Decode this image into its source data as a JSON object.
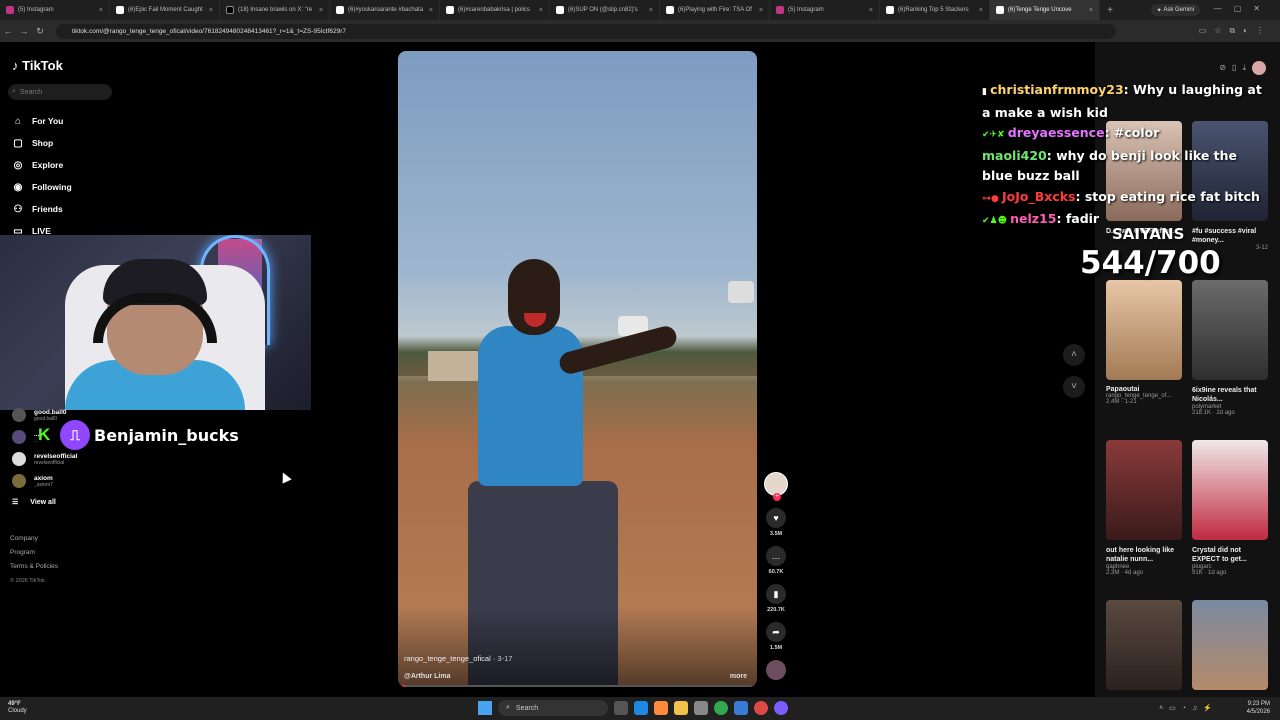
{
  "browser": {
    "tabs": [
      {
        "title": "(5) Instagram"
      },
      {
        "title": "(6)Epic Fail Moment Caught"
      },
      {
        "title": "(18) Insane brawls on X: \"re"
      },
      {
        "title": "(6)#yoskaroarante #bachata"
      },
      {
        "title": "(6)#carenbabakrisa | polics"
      },
      {
        "title": "(6)SUP ON (@slip.cn82)'s"
      },
      {
        "title": "(6)Playing with Fire: TSA Of"
      },
      {
        "title": "(5) Instagram"
      },
      {
        "title": "(6)Ranking Top 5 Stackers"
      },
      {
        "title": "(6)Tenge Tenge Uncove"
      }
    ],
    "new_tab": "+",
    "ask_gemini": "Ask Gemini",
    "url": "tiktok.com/@rango_tenge_tenge_ofical/video/7618249480248413461?_r=1&_t=ZS-95Ictf629r7"
  },
  "sidebar": {
    "logo": "TikTok",
    "search_placeholder": "Search",
    "nav": [
      {
        "label": "For You",
        "icon": "home-icon"
      },
      {
        "label": "Shop",
        "icon": "bag-icon"
      },
      {
        "label": "Explore",
        "icon": "compass-icon"
      },
      {
        "label": "Following",
        "icon": "following-icon"
      },
      {
        "label": "Friends",
        "icon": "friends-icon"
      },
      {
        "label": "LIVE",
        "icon": "live-icon"
      }
    ],
    "following": [
      {
        "name": "good.ball0",
        "handle": "good.ball0"
      },
      {
        "name": "...",
        "handle": "..."
      },
      {
        "name": "revelseofficial",
        "handle": "revelseofficial"
      },
      {
        "name": "axiom",
        "handle": "_axiom7"
      }
    ],
    "view_all": "View all",
    "footer": [
      "Company",
      "Program",
      "Terms & Policies"
    ],
    "copyright": "© 2026 TikTok"
  },
  "stream_overlay": {
    "streamer_name": "Benjamin_bucks",
    "group_label": "SAIYANS",
    "counter": "544/700",
    "chat": [
      {
        "user": "christianfrmmoy23",
        "message": "Why u laughing at a make a wish kid"
      },
      {
        "user": "dreyaessence",
        "message": "#color"
      },
      {
        "user": "maoli420",
        "message": "why do benji look like the blue buzz ball"
      },
      {
        "user": "JoJo_Bxcks",
        "message": "stop eating rice fat bitch"
      },
      {
        "user": "nelz15",
        "message": "fadir"
      }
    ]
  },
  "video": {
    "author": "rango_tenge_tenge_ofical",
    "date": "3-17",
    "description": "@Arthur Lima",
    "more": "more",
    "progress": 0.02,
    "likes": "3.5M",
    "comments": "60.7K",
    "saves": "220.7K",
    "shares": "1.5M"
  },
  "recommendations": [
    {
      "title": "",
      "author": "",
      "meta": ""
    },
    {
      "title": "",
      "author": "",
      "meta": ""
    },
    {
      "title": "D... was OVER after...",
      "author": "",
      "meta": ""
    },
    {
      "title": "#fu #success #viral #money...",
      "author": "",
      "meta": "3-12"
    },
    {
      "title": "Papaoutai",
      "author": "rango_tenge_tenge_of...",
      "meta": "2.4M · 1-21"
    },
    {
      "title": "6ix9ine reveals that Nicolás...",
      "author": "polymarket",
      "meta": "218.1K · 2d ago"
    },
    {
      "title": "out here looking like natalie nunn...",
      "author": "qaphnee",
      "meta": "2.3M · 4d ago"
    },
    {
      "title": "Crystal did not EXPECT to get...",
      "author": "plugarc",
      "meta": "91K · 1d ago"
    },
    {
      "title": "",
      "author": "",
      "meta": ""
    },
    {
      "title": "",
      "author": "",
      "meta": ""
    }
  ],
  "taskbar": {
    "weather_temp": "49°F",
    "weather_desc": "Cloudy",
    "search": "Search",
    "time": "9:23 PM",
    "date": "4/5/2026"
  }
}
